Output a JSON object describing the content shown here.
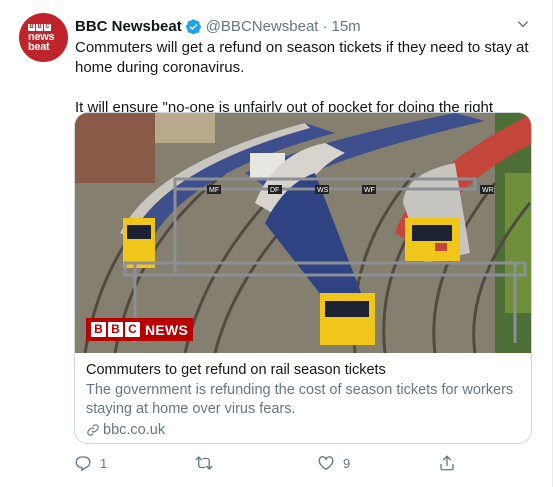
{
  "tweet": {
    "display_name": "BBC Newsbeat",
    "handle": "@BBCNewsbeat",
    "separator": "·",
    "time": "15m",
    "paragraphs": [
      "Commuters will get a refund on season tickets if they need to stay at home during coronavirus.",
      "It will ensure \"no-one is unfairly out of pocket for doing the right thing\"."
    ],
    "avatar": {
      "logo_letters": [
        "B",
        "B",
        "C"
      ],
      "line1": "news",
      "line2": "beat"
    }
  },
  "card": {
    "image_icon": "trains-photo",
    "watermark_letters": [
      "B",
      "B",
      "C"
    ],
    "watermark_word": "NEWS",
    "title": "Commuters to get refund on rail season tickets",
    "description": "The government is refunding the cost of season tickets for workers staying at home over virus fears.",
    "domain": "bbc.co.uk",
    "link_icon": "link-icon"
  },
  "actions": {
    "reply_count": "1",
    "retweet_count": "",
    "like_count": "9",
    "icons": [
      "reply-icon",
      "retweet-icon",
      "like-icon",
      "share-icon"
    ]
  },
  "colors": {
    "accent": "#1da1f2",
    "muted": "#657786",
    "bbc_red": "#b80000"
  }
}
